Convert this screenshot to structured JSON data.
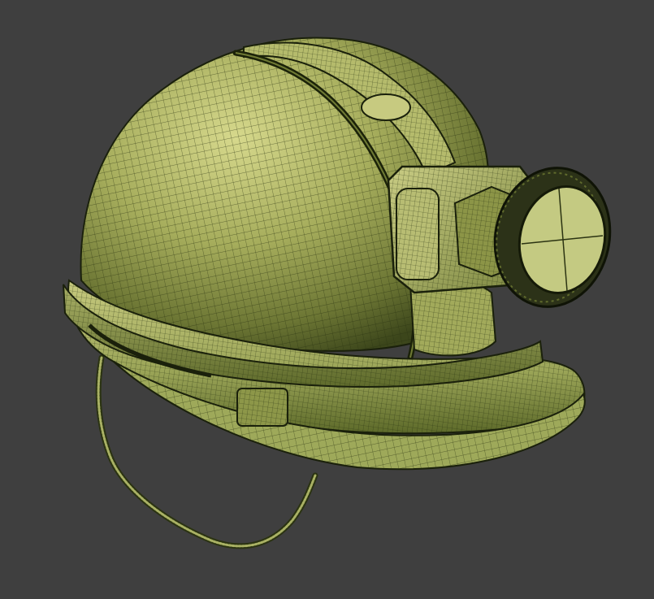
{
  "scene": {
    "subject": "miner-helmet-wireframe",
    "colors": {
      "background": "#3f3f3f",
      "shell_light": "#c2c57a",
      "shell_mid": "#8f9a4c",
      "shell_dark": "#3f4a1d",
      "wire": "#1e2510",
      "lens": "#c8cf85",
      "lamp_dark": "#2a2f1a"
    }
  }
}
